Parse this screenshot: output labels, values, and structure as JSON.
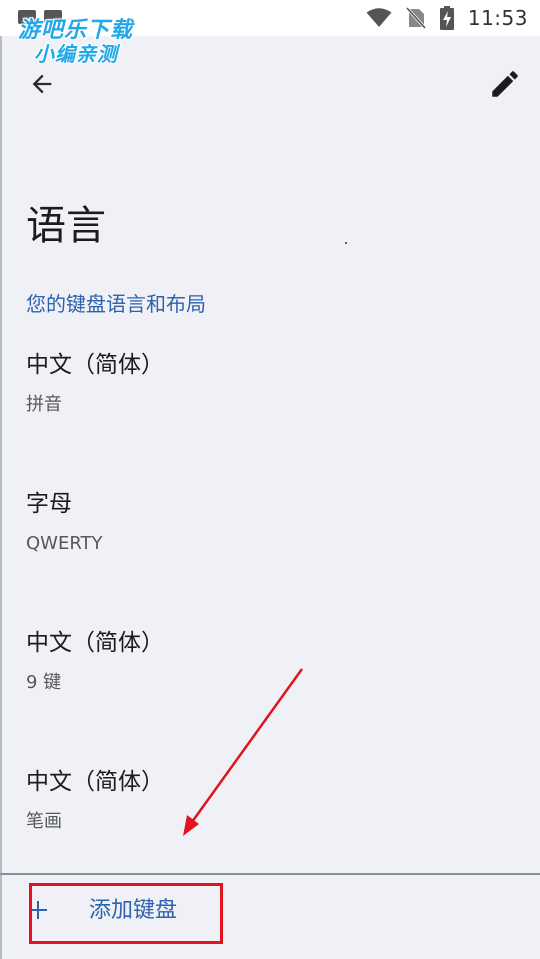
{
  "status_bar": {
    "time": "11:53",
    "icons": [
      "notification-icon",
      "image-icon",
      "wifi-icon",
      "no-sim-icon",
      "battery-charging-icon"
    ]
  },
  "watermark": {
    "line1": "游吧乐下载",
    "line2": "小编亲测"
  },
  "toolbar": {
    "back_icon": "arrow-back-icon",
    "edit_icon": "pencil-edit-icon"
  },
  "page": {
    "title": "语言",
    "section_header": "您的键盘语言和布局"
  },
  "keyboards": [
    {
      "title": "中文（简体）",
      "subtitle": "拼音"
    },
    {
      "title": "字母",
      "subtitle": "QWERTY"
    },
    {
      "title": "中文（简体）",
      "subtitle": "9 键"
    },
    {
      "title": "中文（简体）",
      "subtitle": "笔画"
    }
  ],
  "add_keyboard": {
    "icon": "plus-icon",
    "label": "添加键盘"
  },
  "colors": {
    "accent": "#2e62ae",
    "background": "#eff1f6",
    "annotation": "#e0141e",
    "watermark": "#22a8e8"
  }
}
